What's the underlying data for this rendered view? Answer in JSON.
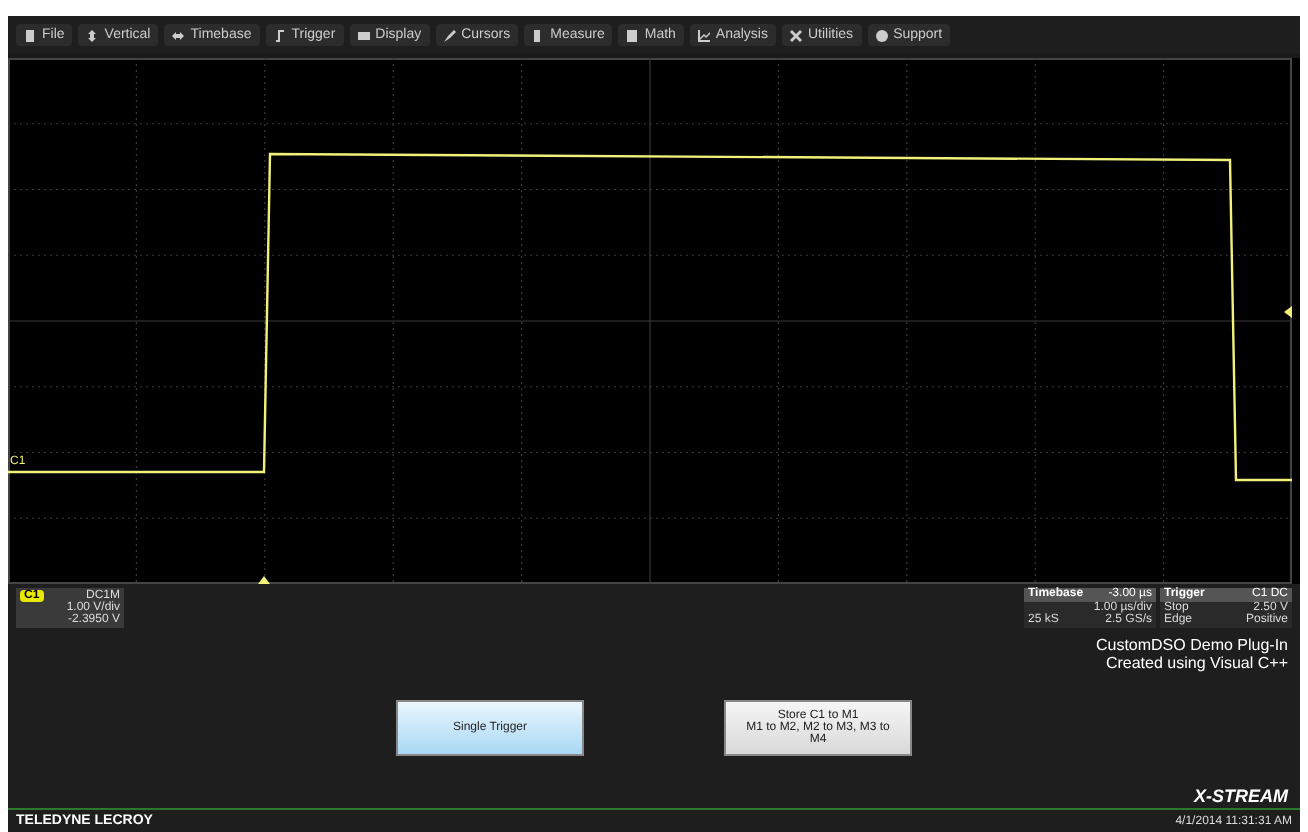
{
  "menu": [
    {
      "label": "File",
      "kind": "file"
    },
    {
      "label": "Vertical",
      "kind": "vertical"
    },
    {
      "label": "Timebase",
      "kind": "timebase"
    },
    {
      "label": "Trigger",
      "kind": "trigger"
    },
    {
      "label": "Display",
      "kind": "display"
    },
    {
      "label": "Cursors",
      "kind": "cursors"
    },
    {
      "label": "Measure",
      "kind": "measure"
    },
    {
      "label": "Math",
      "kind": "math"
    },
    {
      "label": "Analysis",
      "kind": "analysis"
    },
    {
      "label": "Utilities",
      "kind": "utilities"
    },
    {
      "label": "Support",
      "kind": "support"
    }
  ],
  "grid": {
    "trace_marker": "C1"
  },
  "channel": {
    "name": "C1",
    "coupling": "DC1M",
    "scale": "1.00 V/div",
    "offset": "-2.3950 V"
  },
  "timebase": {
    "title": "Timebase",
    "delay": "-3.00 µs",
    "scale": "1.00 µs/div",
    "samples": "25 kS",
    "rate": "2.5 GS/s"
  },
  "trigger": {
    "title": "Trigger",
    "source": "C1 DC",
    "mode": "Stop",
    "level": "2.50 V",
    "type": "Edge",
    "slope": "Positive"
  },
  "plugin_text": [
    "CustomDSO Demo Plug-In",
    "Created using Visual C++"
  ],
  "buttons": [
    {
      "lines": [
        "Single Trigger"
      ],
      "kind": "blue"
    },
    {
      "lines": [
        "Store C1 to M1",
        "M1 to M2, M2 to M3, M3 to M4"
      ],
      "kind": "grey"
    }
  ],
  "footer": {
    "brand": "TELEDYNE LECROY",
    "logo": "X-STREAM",
    "datetime": "4/1/2014 11:31:31 AM"
  }
}
